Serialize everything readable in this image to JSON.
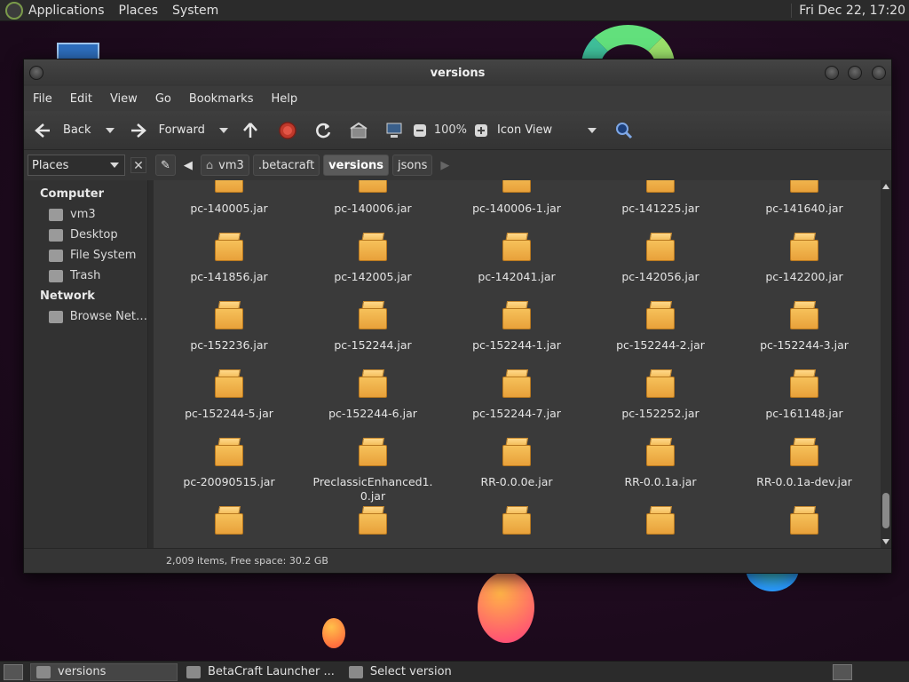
{
  "top_panel": {
    "menus": [
      "Applications",
      "Places",
      "System"
    ],
    "clock": "Fri Dec 22, 17:20"
  },
  "window": {
    "title": "versions",
    "menubar": [
      "File",
      "Edit",
      "View",
      "Go",
      "Bookmarks",
      "Help"
    ],
    "toolbar": {
      "back": "Back",
      "forward": "Forward",
      "zoom": "100%",
      "view_mode": "Icon View"
    },
    "sidebar_selector": "Places",
    "breadcrumbs": [
      "vm3",
      ".betacraft",
      "versions",
      "jsons"
    ],
    "active_crumb": "versions",
    "sidebar": {
      "sections": [
        {
          "heading": "Computer",
          "items": [
            "vm3",
            "Desktop",
            "File System",
            "Trash"
          ]
        },
        {
          "heading": "Network",
          "items": [
            "Browse Net…"
          ]
        }
      ]
    },
    "files": [
      "pc-140005.jar",
      "pc-140006.jar",
      "pc-140006-1.jar",
      "pc-141225.jar",
      "pc-141640.jar",
      "pc-141856.jar",
      "pc-142005.jar",
      "pc-142041.jar",
      "pc-142056.jar",
      "pc-142200.jar",
      "pc-152236.jar",
      "pc-152244.jar",
      "pc-152244-1.jar",
      "pc-152244-2.jar",
      "pc-152244-3.jar",
      "pc-152244-5.jar",
      "pc-152244-6.jar",
      "pc-152244-7.jar",
      "pc-152252.jar",
      "pc-161148.jar",
      "pc-20090515.jar",
      "PreclassicEnhanced1.\n0.jar",
      "RR-0.0.0e.jar",
      "RR-0.0.1a.jar",
      "RR-0.0.1a-dev.jar",
      "",
      "",
      "",
      "",
      ""
    ],
    "status": "2,009 items, Free space: 30.2 GB"
  },
  "taskbar": {
    "tasks": [
      "versions",
      "BetaCraft Launcher ...",
      "Select version"
    ]
  }
}
